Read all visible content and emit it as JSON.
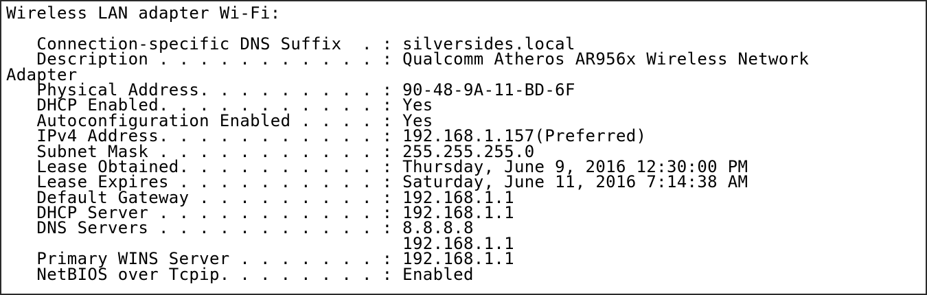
{
  "adapter_header": "Wireless LAN adapter Wi-Fi:",
  "entries": {
    "dns_suffix": "   Connection-specific DNS Suffix  . : silversides.local",
    "description": "   Description . . . . . . . . . . . : Qualcomm Atheros AR956x Wireless Network",
    "description_wrap": "Adapter",
    "physical_address": "   Physical Address. . . . . . . . . : 90-48-9A-11-BD-6F",
    "dhcp_enabled": "   DHCP Enabled. . . . . . . . . . . : Yes",
    "autoconfig_enabled": "   Autoconfiguration Enabled . . . . : Yes",
    "ipv4_address": "   IPv4 Address. . . . . . . . . . . : 192.168.1.157(Preferred)",
    "subnet_mask": "   Subnet Mask . . . . . . . . . . . : 255.255.255.0",
    "lease_obtained": "   Lease Obtained. . . . . . . . . . : Thursday, June 9, 2016 12:30:00 PM",
    "lease_expires": "   Lease Expires . . . . . . . . . . : Saturday, June 11, 2016 7:14:38 AM",
    "default_gateway": "   Default Gateway . . . . . . . . . : 192.168.1.1",
    "dhcp_server": "   DHCP Server . . . . . . . . . . . : 192.168.1.1",
    "dns_servers": "   DNS Servers . . . . . . . . . . . : 8.8.8.8",
    "dns_servers_2": "                                       192.168.1.1",
    "primary_wins": "   Primary WINS Server . . . . . . . : 192.168.1.1",
    "netbios": "   NetBIOS over Tcpip. . . . . . . . : Enabled"
  }
}
